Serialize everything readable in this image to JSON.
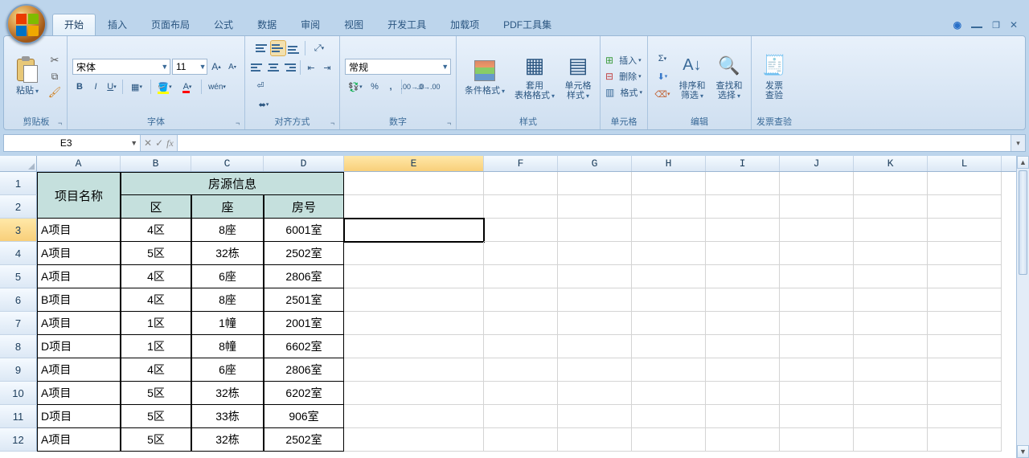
{
  "tabs": [
    "开始",
    "插入",
    "页面布局",
    "公式",
    "数据",
    "审阅",
    "视图",
    "开发工具",
    "加载项",
    "PDF工具集"
  ],
  "active_tab": 0,
  "groups": {
    "clipboard": {
      "label": "剪贴板",
      "paste": "粘贴"
    },
    "font": {
      "label": "字体",
      "name": "宋体",
      "size": "11"
    },
    "align": {
      "label": "对齐方式"
    },
    "number": {
      "label": "数字",
      "format": "常规"
    },
    "styles": {
      "label": "样式",
      "cond": "条件格式",
      "tbl": "套用\n表格格式",
      "cell": "单元格\n样式"
    },
    "cells": {
      "label": "单元格",
      "ins": "插入",
      "del": "删除",
      "fmt": "格式"
    },
    "edit": {
      "label": "编辑",
      "sort": "排序和\n筛选",
      "find": "查找和\n选择"
    },
    "invoice": {
      "label": "发票查验",
      "btn": "发票\n查验"
    }
  },
  "namebox": "E3",
  "formula": "",
  "columns": [
    "A",
    "B",
    "C",
    "D",
    "E",
    "F",
    "G",
    "H",
    "I",
    "J",
    "K",
    "L"
  ],
  "col_classes": [
    "wA",
    "wB",
    "wC",
    "wD",
    "wE",
    "wF",
    "wG",
    "wH",
    "wI",
    "wJ",
    "wK",
    "wL"
  ],
  "active_cell": {
    "row": 3,
    "col": "E"
  },
  "header": {
    "merged_project": "项目名称",
    "merged_info": "房源信息",
    "sub": [
      "区",
      "座",
      "房号"
    ]
  },
  "data_rows": [
    [
      "A项目",
      "4区",
      "8座",
      "6001室"
    ],
    [
      "A项目",
      "5区",
      "32栋",
      "2502室"
    ],
    [
      "A项目",
      "4区",
      "6座",
      "2806室"
    ],
    [
      "B项目",
      "4区",
      "8座",
      "2501室"
    ],
    [
      "A项目",
      "1区",
      "1幢",
      "2001室"
    ],
    [
      "D项目",
      "1区",
      "8幢",
      "6602室"
    ],
    [
      "A项目",
      "4区",
      "6座",
      "2806室"
    ],
    [
      "A项目",
      "5区",
      "32栋",
      "6202室"
    ],
    [
      "D项目",
      "5区",
      "33栋",
      "906室"
    ],
    [
      "A项目",
      "5区",
      "32栋",
      "2502室"
    ]
  ]
}
